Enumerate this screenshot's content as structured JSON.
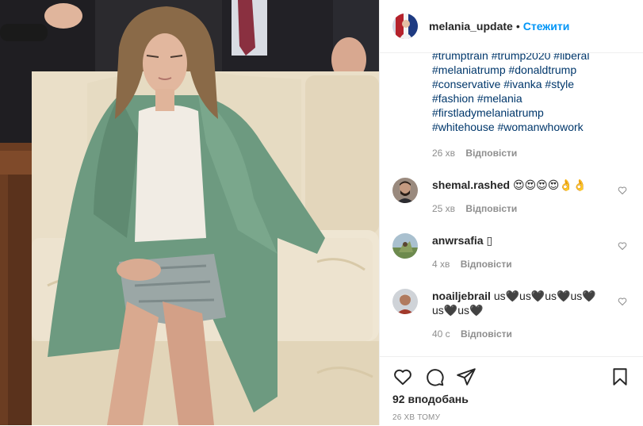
{
  "header": {
    "username": "melania_update",
    "separator": "•",
    "follow_label": "Стежити"
  },
  "caption": {
    "lines": [
      "#trumptrain #trump2020 #liberal",
      "#melaniatrump #donaldtrump",
      "#conservative #ivanka #style",
      "#fashion #melania",
      "#firstladymelaniatrump",
      "#whitehouse #womanwhowork"
    ],
    "time": "26 хв",
    "reply_label": "Відповісти"
  },
  "comments": [
    {
      "username": "shemal.rashed",
      "text": "😍😍😍😍👌👌",
      "time": "25 хв",
      "reply_label": "Відповісти"
    },
    {
      "username": "anwrsafia",
      "text": "▯",
      "time": "4 хв",
      "reply_label": "Відповісти"
    },
    {
      "username": "noailjebrail",
      "text": "us🖤us🖤us🖤us🖤us🖤us🖤",
      "time": "40 с",
      "reply_label": "Відповісти"
    }
  ],
  "footer": {
    "likes": "92 вподобань",
    "time_ago": "26 ХВ ТОМУ"
  },
  "icons": {
    "like": "heart-outline-icon",
    "comment": "speech-bubble-icon",
    "share": "paper-plane-icon",
    "save": "bookmark-icon"
  },
  "colors": {
    "follow": "#0095f6",
    "hashtag": "#00376b",
    "muted": "#8e8e8e"
  }
}
